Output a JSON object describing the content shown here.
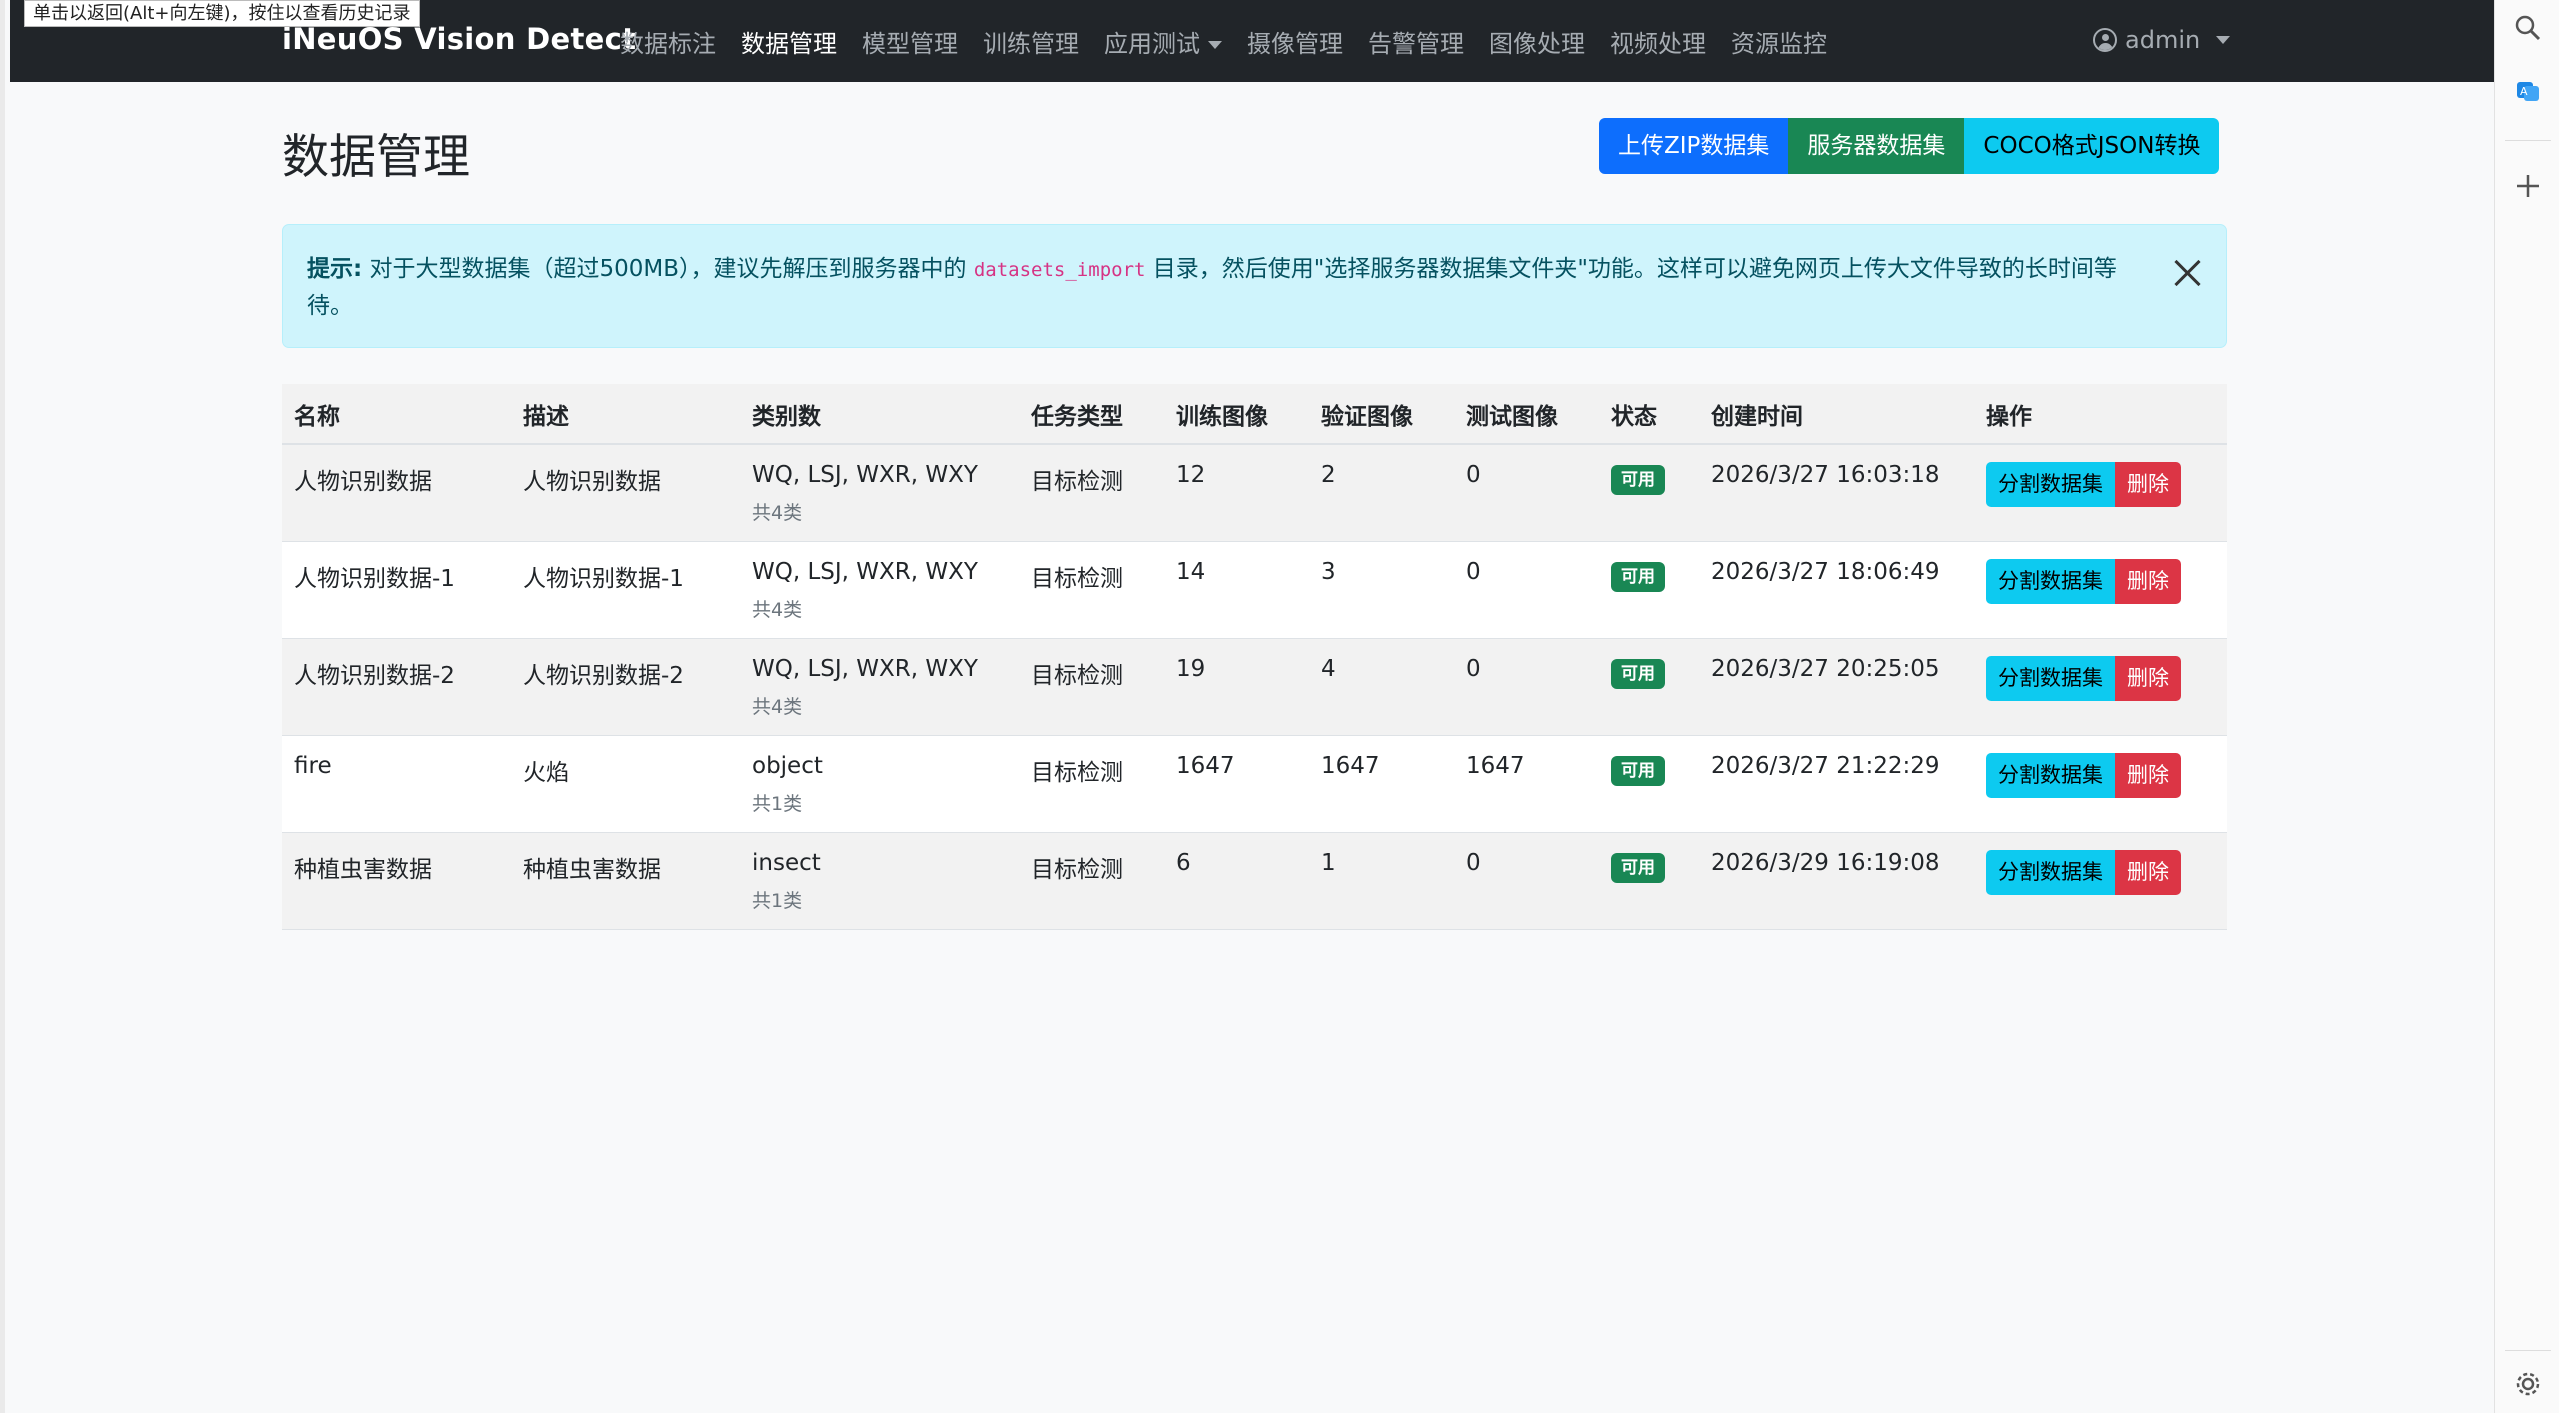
{
  "tooltip": "单击以返回(Alt+向左键)，按住以查看历史记录",
  "navbar": {
    "brand": "iNeuOS Vision Detect",
    "links": [
      "数据标注",
      "数据管理",
      "模型管理",
      "训练管理",
      "应用测试",
      "摄像管理",
      "告警管理",
      "图像处理",
      "视频处理",
      "资源监控"
    ],
    "active_index": 1,
    "dropdown_index": 4,
    "user": "admin"
  },
  "page": {
    "title": "数据管理",
    "buttons": {
      "upload_zip": "上传ZIP数据集",
      "server_dataset": "服务器数据集",
      "coco_convert": "COCO格式JSON转换"
    }
  },
  "alert": {
    "label": "提示:",
    "text_before": "对于大型数据集（超过500MB），建议先解压到服务器中的",
    "code": "datasets_import",
    "text_after": "目录，然后使用\"选择服务器数据集文件夹\"功能。这样可以避免网页上传大文件导致的长时间等待。"
  },
  "table": {
    "headers": [
      "名称",
      "描述",
      "类别数",
      "任务类型",
      "训练图像",
      "验证图像",
      "测试图像",
      "状态",
      "创建时间",
      "操作"
    ],
    "rows": [
      {
        "name": "人物识别数据",
        "desc": "人物识别数据",
        "classes": "WQ, LSJ, WXR, WXY",
        "class_count": "共4类",
        "task": "目标检测",
        "train": "12",
        "val": "2",
        "test": "0",
        "status": "可用",
        "created": "2026/3/27 16:03:18"
      },
      {
        "name": "人物识别数据-1",
        "desc": "人物识别数据-1",
        "classes": "WQ, LSJ, WXR, WXY",
        "class_count": "共4类",
        "task": "目标检测",
        "train": "14",
        "val": "3",
        "test": "0",
        "status": "可用",
        "created": "2026/3/27 18:06:49"
      },
      {
        "name": "人物识别数据-2",
        "desc": "人物识别数据-2",
        "classes": "WQ, LSJ, WXR, WXY",
        "class_count": "共4类",
        "task": "目标检测",
        "train": "19",
        "val": "4",
        "test": "0",
        "status": "可用",
        "created": "2026/3/27 20:25:05"
      },
      {
        "name": "fire",
        "desc": "火焰",
        "classes": "object",
        "class_count": "共1类",
        "task": "目标检测",
        "train": "1647",
        "val": "1647",
        "test": "1647",
        "status": "可用",
        "created": "2026/3/27 21:22:29"
      },
      {
        "name": "种植虫害数据",
        "desc": "种植虫害数据",
        "classes": "insect",
        "class_count": "共1类",
        "task": "目标检测",
        "train": "6",
        "val": "1",
        "test": "0",
        "status": "可用",
        "created": "2026/3/29 16:19:08"
      }
    ],
    "action_split": "分割数据集",
    "action_delete": "删除"
  },
  "colors": {
    "navbar": "#212529",
    "primary": "#0d6efd",
    "success": "#198754",
    "info": "#0dcaf0",
    "danger": "#dc3545",
    "alert_bg": "#cff4fc"
  },
  "sidebar_icons": [
    "search-icon",
    "translate-icon",
    "plus-icon",
    "gear-icon"
  ]
}
